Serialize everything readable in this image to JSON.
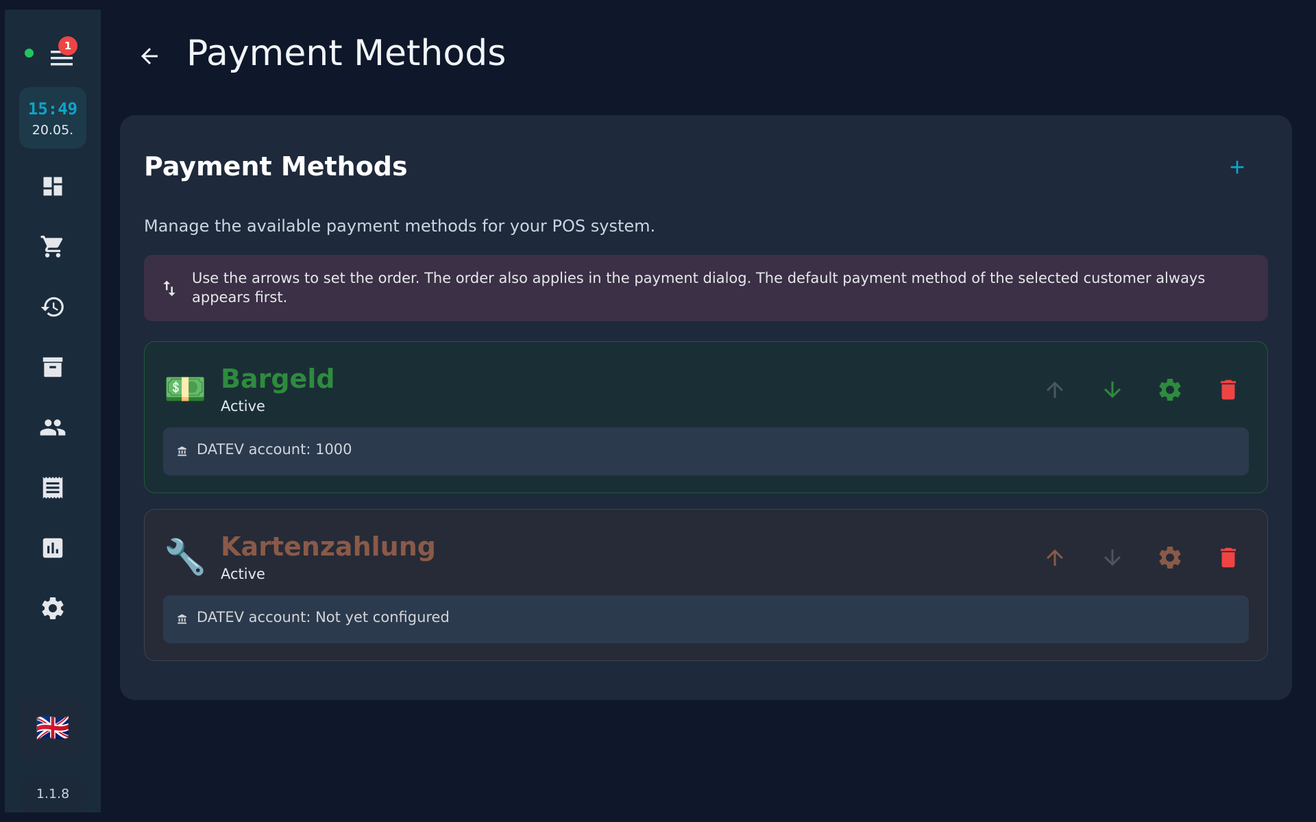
{
  "sidebar": {
    "notifications_count": "1",
    "clock": {
      "time": "15:49",
      "date": "20.05."
    },
    "nav_icons": [
      "dashboard-icon",
      "cart-icon",
      "history-icon",
      "archive-icon",
      "people-icon",
      "receipt-icon",
      "analytics-icon",
      "settings-icon"
    ],
    "language_flag": "🇬🇧",
    "version": "1.1.8"
  },
  "header": {
    "title": "Payment Methods"
  },
  "card": {
    "title": "Payment Methods",
    "description": "Manage the available payment methods for your POS system.",
    "info": "Use the arrows to set the order. The order also applies in the payment dialog. The default payment method of the selected customer always appears first."
  },
  "payment_methods": [
    {
      "icon": "💵",
      "name": "Bargeld",
      "status": "Active",
      "datev": "DATEV account: 1000",
      "accent": "#2e8b3e"
    },
    {
      "icon": "🔧",
      "name": "Kartenzahlung",
      "status": "Active",
      "datev": "DATEV account: Not yet configured",
      "accent": "#8a5a48"
    }
  ],
  "colors": {
    "background": "#0f172a",
    "sidebar": "#1a2b3c",
    "card": "#1e293b",
    "accent_blue": "#0ea5c9",
    "delete_red": "#ef4444",
    "status_green": "#22c55e"
  }
}
